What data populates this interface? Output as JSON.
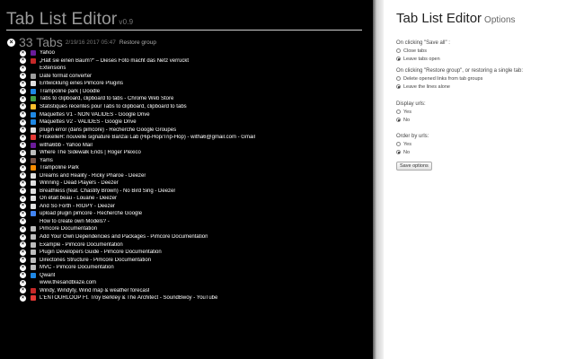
{
  "header": {
    "title": "Tab List Editor",
    "version": "v0.9"
  },
  "group": {
    "count_label": "33 Tabs",
    "date": "2/19/16 2017 05:47",
    "restore_label": "Restore group",
    "close_glyph": "×"
  },
  "tabs": [
    {
      "title": "Yahoo",
      "favicon_color": "#6a1b9a"
    },
    {
      "title": "„Hält sie einen Baum?“ – Dieses Foto macht das Netz verrückt",
      "favicon_color": "#c62828"
    },
    {
      "title": "Extensions",
      "favicon_color": ""
    },
    {
      "title": "Date format converter",
      "favicon_color": "#9e9e9e"
    },
    {
      "title": "Entwicklung eines Pimcore Plugins",
      "favicon_color": "#e0e0e0"
    },
    {
      "title": "Trampoline park | Doodle",
      "favicon_color": "#1e88e5"
    },
    {
      "title": "Tabs to clipboard, clipboard to tabs - Chrome Web Store",
      "favicon_color": "#43a047"
    },
    {
      "title": "Statistiques récentes pour Tabs to clipboard, clipboard to tabs",
      "favicon_color": "#fbc02d"
    },
    {
      "title": "Maquettes V1 - NON VALIDES - Google Drive",
      "favicon_color": "#1e88e5"
    },
    {
      "title": "Maquettes V2 - VALIDES - Google Drive",
      "favicon_color": "#1e88e5"
    },
    {
      "title": "plugin error (dans pimcore) - Recherche Google Groupes",
      "favicon_color": "#e0e0e0"
    },
    {
      "title": "FriskelleR: nouvelle signature Banzai Lab (Hip-Hop/Trip-Hop) - witha6@gmail.com - Gmail",
      "favicon_color": "#e53935"
    },
    {
      "title": "witha6bb - Yahoo Mail",
      "favicon_color": "#6a1b9a"
    },
    {
      "title": "Where The Sidewalk Ends | Roger Plexico",
      "favicon_color": "#bdbdbd"
    },
    {
      "title": "Yams",
      "favicon_color": "#795548"
    },
    {
      "title": "Trampoline Park",
      "favicon_color": "#fb8c00"
    },
    {
      "title": "Dreams and Reality - Ricky Pharoe - Deezer",
      "favicon_color": "#e0e0e0"
    },
    {
      "title": "Winning - Dead Players - Deezer",
      "favicon_color": "#e0e0e0"
    },
    {
      "title": "Breathless (feat. Chastity Brown) - No Bird Sing - Deezer",
      "favicon_color": "#e0e0e0"
    },
    {
      "title": "On était beau - Louane - Deezer",
      "favicon_color": "#e0e0e0"
    },
    {
      "title": "And So Forth - RIOPY - Deezer",
      "favicon_color": "#e0e0e0"
    },
    {
      "title": "upload plugin pimcore - Recherche Google",
      "favicon_color": "#4285f4"
    },
    {
      "title": "How to create own Models? -",
      "favicon_color": ""
    },
    {
      "title": "Pimcore Documentation",
      "favicon_color": "#bdbdbd"
    },
    {
      "title": "Add Your Own Dependencies and Packages - Pimcore Documentation",
      "favicon_color": "#bdbdbd"
    },
    {
      "title": "Example - Pimcore Documentation",
      "favicon_color": "#bdbdbd"
    },
    {
      "title": "Plugin Developers Guide - Pimcore Documentation",
      "favicon_color": "#bdbdbd"
    },
    {
      "title": "Directories Structure - Pimcore Documentation",
      "favicon_color": "#bdbdbd"
    },
    {
      "title": "MVC - Pimcore Documentation",
      "favicon_color": "#bdbdbd"
    },
    {
      "title": "Qwant",
      "favicon_color": "#1e88e5"
    },
    {
      "title": "www.thesandblaze.com",
      "favicon_color": ""
    },
    {
      "title": "Windy, Windyty, Wind map & weather forecast",
      "favicon_color": "#c62828"
    },
    {
      "title": "L'ENTOURLOOP Ft. Troy Berkley & The Architect - SoundBwoy - YouTube",
      "favicon_color": "#e53935"
    }
  ],
  "options": {
    "title": "Tab List Editor",
    "subtitle": "Options",
    "save_all_label": "On clicking \"Save all\" :",
    "save_all_choices": [
      "Close tabs",
      "Leave tabs open"
    ],
    "save_all_selected": 1,
    "restore_label": "On clicking \"Restore group\", or restoring a single tab:",
    "restore_choices": [
      "Delete opened links from tab groups",
      "Leave the lines alone"
    ],
    "restore_selected": 1,
    "display_urls_label": "Display urls:",
    "display_urls_choices": [
      "Yes",
      "No"
    ],
    "display_urls_selected": 1,
    "order_urls_label": "Order by urls:",
    "order_urls_choices": [
      "Yes",
      "No"
    ],
    "order_urls_selected": 1,
    "save_button": "Save options"
  },
  "colors": {
    "left_bg": "#000000",
    "right_bg": "#ffffff",
    "title_gray": "#9a9a9a"
  }
}
